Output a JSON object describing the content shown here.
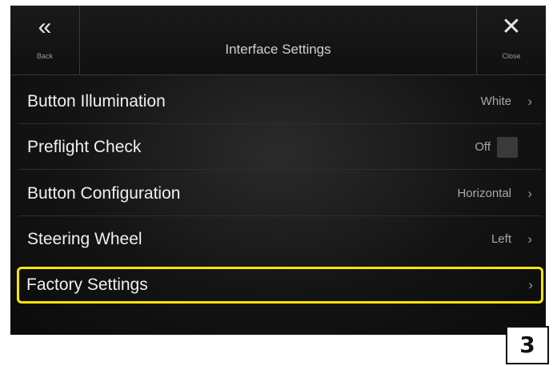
{
  "header": {
    "title": "Interface Settings",
    "back": {
      "glyph": "«",
      "label": "Back",
      "icon": "double-chevron-left-icon"
    },
    "close": {
      "glyph": "✕",
      "label": "Close",
      "icon": "close-icon"
    }
  },
  "rows": [
    {
      "label": "Button Illumination",
      "value": "White",
      "chevron": "›"
    },
    {
      "label": "Preflight Check",
      "value": "Off",
      "toggle": false
    },
    {
      "label": "Button Configuration",
      "value": "Horizontal",
      "chevron": "›"
    },
    {
      "label": "Steering Wheel",
      "value": "Left",
      "chevron": "›"
    },
    {
      "label": "Factory Settings",
      "value": "",
      "chevron": "›",
      "highlighted": true
    }
  ],
  "step_badge": "3",
  "colors": {
    "highlight": "#ffe600",
    "background": "#141414",
    "text": "#f0f0f0"
  }
}
